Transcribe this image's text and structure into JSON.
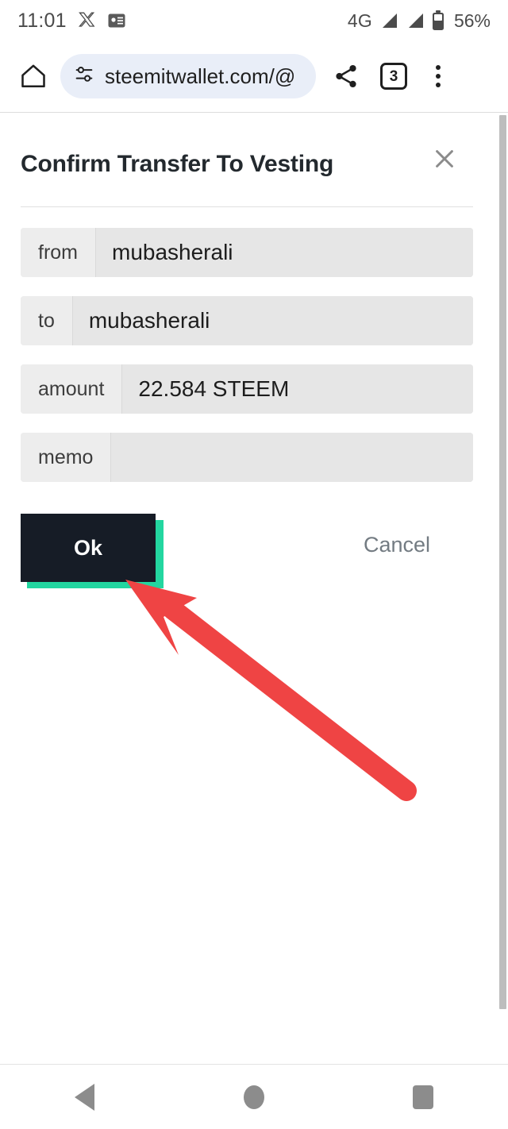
{
  "status_bar": {
    "clock": "11:01",
    "icons": [
      "x-app-icon",
      "contact-card-icon"
    ],
    "network_type": "4G",
    "signal_icons": [
      "signal-bars-icon",
      "signal-bars-icon"
    ],
    "battery_icon": "battery-icon",
    "battery_percent": "56%"
  },
  "browser": {
    "home_icon": "home-icon",
    "permissions_icon": "page-info-tune-icon",
    "url": "steemitwallet.com/@",
    "share_icon": "share-icon",
    "tab_count": "3",
    "menu_icon": "three-dot-menu-icon"
  },
  "dialog": {
    "title": "Confirm Transfer To Vesting",
    "close_icon": "close-icon",
    "rows": [
      {
        "label": "from",
        "value": "mubasherali"
      },
      {
        "label": "to",
        "value": "mubasherali"
      },
      {
        "label": "amount",
        "value": "22.584 STEEM"
      },
      {
        "label": "memo",
        "value": ""
      }
    ],
    "ok_label": "Ok",
    "cancel_label": "Cancel"
  },
  "annotation": {
    "arrow_color": "#ef4444",
    "points_at": "ok-button"
  },
  "colors": {
    "ok_button_bg": "#161c26",
    "ok_button_shadow": "#23d6a0",
    "cancel_text": "#737b82",
    "row_label_bg": "#ededed",
    "row_value_bg": "#e6e6e6",
    "url_pill_bg": "#e9eef8"
  },
  "nav_bar": {
    "back_icon": "back-triangle-icon",
    "home_icon": "home-circle-icon",
    "recents_icon": "recents-square-icon"
  }
}
